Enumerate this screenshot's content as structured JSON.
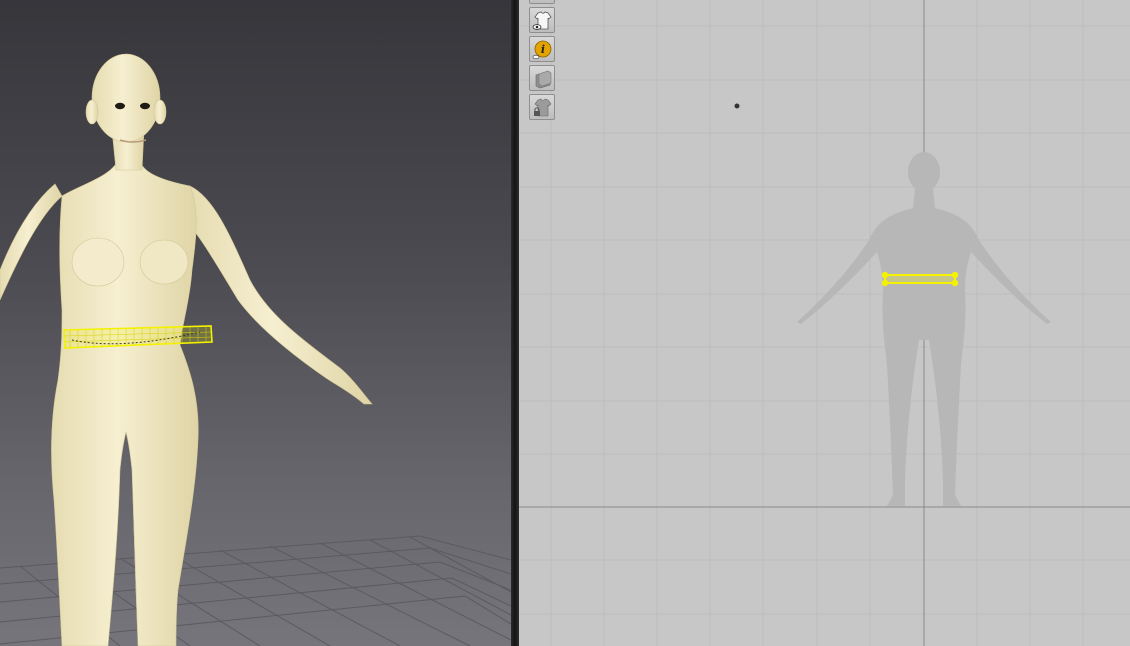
{
  "viewport_3d": {
    "grid_floor": true,
    "avatar_skin_color": "#f1e8c6",
    "selection_color": "#f4f200"
  },
  "viewport_2d": {
    "background_color": "#c7c7c7",
    "grid_color": "#bbbbbb",
    "axis_color": "#8a8a8a",
    "silhouette_color": "#b7b7b7",
    "selection_color": "#f4f200"
  },
  "toolbar": {
    "buttons": [
      {
        "name": "show-garment-button",
        "icon": "tshirt-eye-icon"
      },
      {
        "name": "info-button",
        "icon": "info-icon"
      },
      {
        "name": "layer-button",
        "icon": "stack-icon"
      },
      {
        "name": "lock-garment-button",
        "icon": "tshirt-lock-icon"
      }
    ]
  }
}
